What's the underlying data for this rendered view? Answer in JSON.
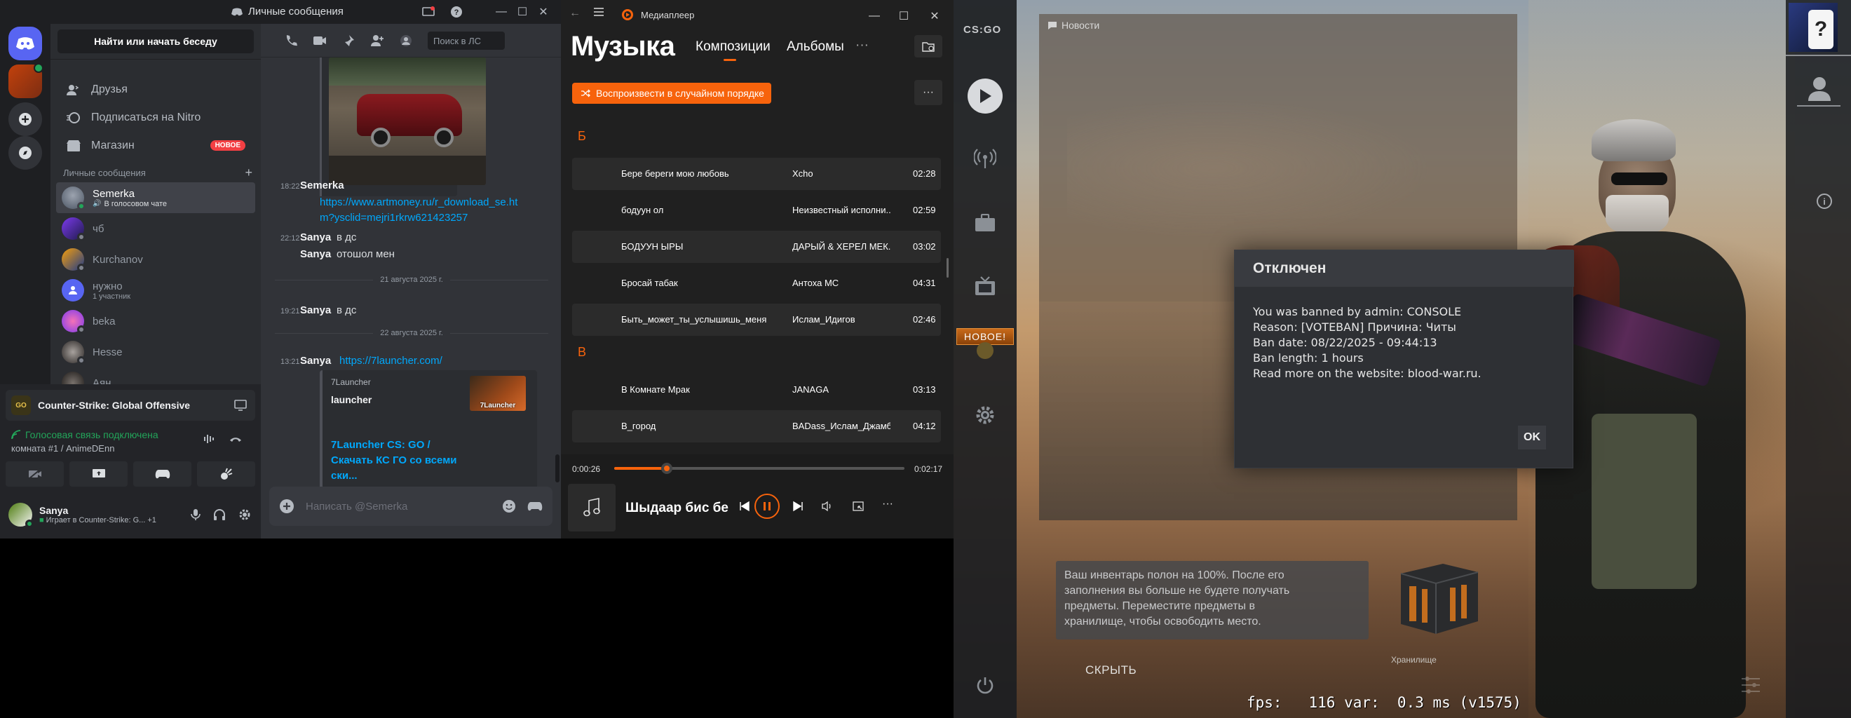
{
  "discord": {
    "window_title": "Личные сообщения",
    "search_button": "Найти или начать беседу",
    "nav": [
      {
        "label": "Друзья"
      },
      {
        "label": "Подписаться на Nitro"
      },
      {
        "label": "Магазин",
        "badge": "НОВОЕ"
      }
    ],
    "dm_section_title": "Личные сообщения",
    "dms": [
      {
        "name": "Semerka",
        "sub": "В голосовом чате",
        "avatar_color": "#6b7280",
        "status_color": "#23a55a"
      },
      {
        "name": "чб",
        "sub": "",
        "avatar_color": "#7c3aed",
        "status_color": "#80848e"
      },
      {
        "name": "Kurchanov",
        "sub": "",
        "avatar_color": "#b45309",
        "status_color": "#80848e"
      },
      {
        "name": "нужно",
        "sub": "1 участник",
        "avatar_color": "#5865f2",
        "status_color": ""
      },
      {
        "name": "beka",
        "sub": "",
        "avatar_color": "#db2777",
        "status_color": "#80848e"
      },
      {
        "name": "Hesse",
        "sub": "",
        "avatar_color": "#78716c",
        "status_color": "#80848e"
      },
      {
        "name": "Аян",
        "sub": "",
        "avatar_color": "#57534e",
        "status_color": "#80848e"
      }
    ],
    "activity": {
      "game": "Counter-Strike: Global Offensive",
      "voice_status": "Голосовая связь подключена",
      "voice_room": "комната #1 / AnimeDEnn"
    },
    "user": {
      "name": "Sanya",
      "status": "Играет в Counter-Strike: G...",
      "extra": "+1"
    },
    "chat": {
      "search_placeholder": "Поиск в ЛС",
      "input_placeholder": "Написать @Semerka",
      "messages": [
        {
          "time": "18:22",
          "author": "Semerka",
          "link": "https://www.artmoney.ru/r_download_se.htm?ysclid=mejri1rkrw621423257"
        },
        {
          "time": "22:12",
          "author": "Sanya",
          "text": "в дс"
        },
        {
          "time": "",
          "author": "Sanya",
          "text": "отошол мен"
        },
        {
          "divider": "21 августа 2025 г."
        },
        {
          "time": "19:21",
          "author": "Sanya",
          "text": "в дс"
        },
        {
          "divider": "22 августа 2025 г."
        },
        {
          "time": "13:21",
          "author": "Sanya",
          "link": "https://7launcher.com/"
        }
      ],
      "link_line1": "https://www.artmoney.ru/r_download_se.ht",
      "link_line2": "m?ysclid=mejri1rkrw621423257",
      "embed": {
        "provider": "7Launcher",
        "title": "launcher",
        "desc1": "7Launcher CS: GO /",
        "desc2": "Скачать КС ГО со всеми",
        "desc3": "ски...",
        "thumb_text": "7Launcher"
      }
    }
  },
  "player": {
    "window_title": "Медиаплеер",
    "heading": "Музыка",
    "tabs": [
      "Композиции",
      "Альбомы",
      "···"
    ],
    "shuffle_label": "Воспроизвести в случайном порядке",
    "groups": [
      {
        "letter": "Б",
        "tracks": [
          {
            "title": "Бере береги мою любовь",
            "artist": "Xcho",
            "duration": "02:28"
          },
          {
            "title": "бодуун ол",
            "artist": "Неизвестный исполни...",
            "duration": "02:59"
          },
          {
            "title": "БОДУУН ЫРЫ",
            "artist": "ДАРЫЙ & ХЕРЕЛ МЕК...",
            "duration": "03:02"
          },
          {
            "title": "Бросай табак",
            "artist": "Антоха МС",
            "duration": "04:31"
          },
          {
            "title": "Быть_может_ты_услышишь_меня",
            "artist": "Ислам_Идигов",
            "duration": "02:46"
          }
        ]
      },
      {
        "letter": "В",
        "tracks": [
          {
            "title": "В Комнате Мрак",
            "artist": "JANAGA",
            "duration": "03:13"
          },
          {
            "title": "В_город",
            "artist": "BADass_Ислам_Джамб...",
            "duration": "04:12"
          }
        ]
      }
    ],
    "now_playing": {
      "title": "Шыдаар бис бе",
      "elapsed": "0:00:26",
      "remaining": "0:02:17",
      "progress_fraction": 0.18
    }
  },
  "csgo": {
    "logo": "CS:GO",
    "news_label": "Новости",
    "new_badge": "НОВОЕ!",
    "dialog": {
      "title": "Отключен",
      "lines": [
        "You was banned by admin: CONSOLE",
        "Reason: [VOTEBAN] Причина: Читы",
        "Ban date: 08/22/2025 - 09:44:13",
        "Ban length: 1 hours",
        "Read more on the website: blood-war.ru."
      ],
      "ok_label": "OK"
    },
    "inventory": {
      "text1": "Ваш инвентарь полон на 100%. После его",
      "text2": "заполнения вы больше не будете получать",
      "text3": "предметы. Переместите предметы в",
      "text4": "хранилище, чтобы освободить место.",
      "storage_label": "Хранилище",
      "hide_label": "СКРЫТЬ"
    },
    "fps_text": "fps:   116 var:  0.3 ms (v1575)"
  }
}
